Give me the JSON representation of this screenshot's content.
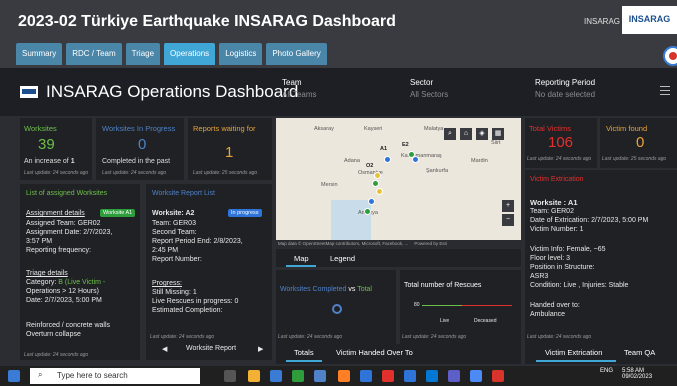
{
  "app": {
    "title": "2023-02 Türkiye Earthquake INSARAG Dashboard",
    "org": "INSARAG",
    "logo_text": "INSARAG"
  },
  "nav": {
    "tabs": [
      "Summary",
      "RDC / Team",
      "Triage",
      "Operations",
      "Logistics",
      "Photo Gallery"
    ],
    "active": "Operations"
  },
  "dashboard": {
    "title": "INSARAG Operations Dashboard"
  },
  "filters": [
    {
      "label": "Team",
      "value": "All Teams"
    },
    {
      "label": "Sector",
      "value": "All Sectors"
    },
    {
      "label": "Reporting Period",
      "value": "No date selected"
    }
  ],
  "kpis": {
    "worksites": {
      "title": "Worksites",
      "value": "39",
      "sub_prefix": "An increase of",
      "sub_value": "1",
      "updated": "Last update: 24 seconds ago"
    },
    "in_progress": {
      "title": "Worksites In Progress",
      "value": "0",
      "sub": "Completed in the past",
      "updated": "Last update: 24 seconds ago"
    },
    "reports_waiting": {
      "title": "Reports waiting for",
      "value": "1",
      "updated": "Last update: 25 seconds ago"
    },
    "total_victims": {
      "title": "Total Victims",
      "value": "106",
      "updated": "Last update: 24 seconds ago"
    },
    "victim_rescue": {
      "title": "Victim found",
      "value": "0",
      "updated": "Last update: 25 seconds ago"
    }
  },
  "assigned": {
    "title": "List of assigned Worksites",
    "details_label": "Assignment details",
    "badge": "Worksite A1",
    "lines": [
      "Assigned Team:  GER02",
      "Assignment Date: 2/7/2023,",
      "3:57 PM",
      "Reporting frequency:"
    ],
    "triage_label": "Triage details",
    "category_prefix": "Category: ",
    "category_value": "B (Live Victim -",
    "category_value2": "Operations > 12 Hours)",
    "date_line": "Date: 2/7/2023, 5:00 PM",
    "extra_lines": [
      "Reinforced / concrete walls",
      "Overturn collapse"
    ],
    "updated": "Last update: 24 seconds ago"
  },
  "report_list": {
    "title": "Worksite Report List",
    "worksite": "Worksite: A2",
    "status": "In progress",
    "lines": [
      "Team: GER03",
      "Second Team:",
      "Report Period End: 2/8/2023,",
      "2:45 PM",
      "Report Number:"
    ],
    "progress_label": "Progress:",
    "progress_lines": [
      "Still Missing: 1",
      "Live Rescues in progress:  0",
      "Estimated Completion:"
    ],
    "updated": "Last update: 24 seconds ago",
    "footer": "Worksite Report"
  },
  "map": {
    "places": [
      "Aksaray",
      "Kayseri",
      "Malatya",
      "Kahramanmaraş",
      "Osmaniye",
      "Mersin",
      "Adana",
      "Şanlıurfa",
      "Mardin",
      "Antakya",
      "Siirt",
      "A1",
      "E2",
      "O2"
    ],
    "attribution": "Map data © OpenStreetMap contributors, Microsoft, Facebook, ...",
    "powered": "Powered by Esri",
    "tabs": [
      "Map",
      "Legend"
    ]
  },
  "completed": {
    "title": "Worksites Completed",
    "vs": "vs",
    "total": "Total",
    "updated": "Last update: 24 seconds ago"
  },
  "rescues": {
    "title": "Total number of Rescues",
    "value": "80",
    "legend_live": "Live",
    "legend_deceased": "Deceased",
    "updated": "Last update: 24 seconds ago"
  },
  "bottom_tabs": {
    "totals": "Totals",
    "handed": "Victim Handed Over To"
  },
  "extrication": {
    "title": "Victim Extrication",
    "worksite": "Worksite : A1",
    "lines": [
      "Team: GER02",
      "Date of Extrication: 2/7/2023, 5:00 PM",
      "Victim Number: 1",
      "",
      "Victim Info: Female, ~65",
      "Floor level:  3",
      "Position in Structure:",
      "ASR3",
      "Condition: Live , Injuries: Stable",
      "",
      "Handed over to:",
      "Ambulance"
    ],
    "updated": "Last update: 24 seconds ago",
    "tabs": [
      "Victim Extrication",
      "Team QA"
    ]
  },
  "taskbar": {
    "search_placeholder": "Type here to search",
    "lang": "ENG",
    "time": "5:58 AM",
    "date": "09/02/2023"
  },
  "colors": {
    "green": "#6cc04a",
    "blue": "#4f82c8",
    "orange": "#e8a33a",
    "red": "#e2312d",
    "accent": "#3fa6d6"
  }
}
